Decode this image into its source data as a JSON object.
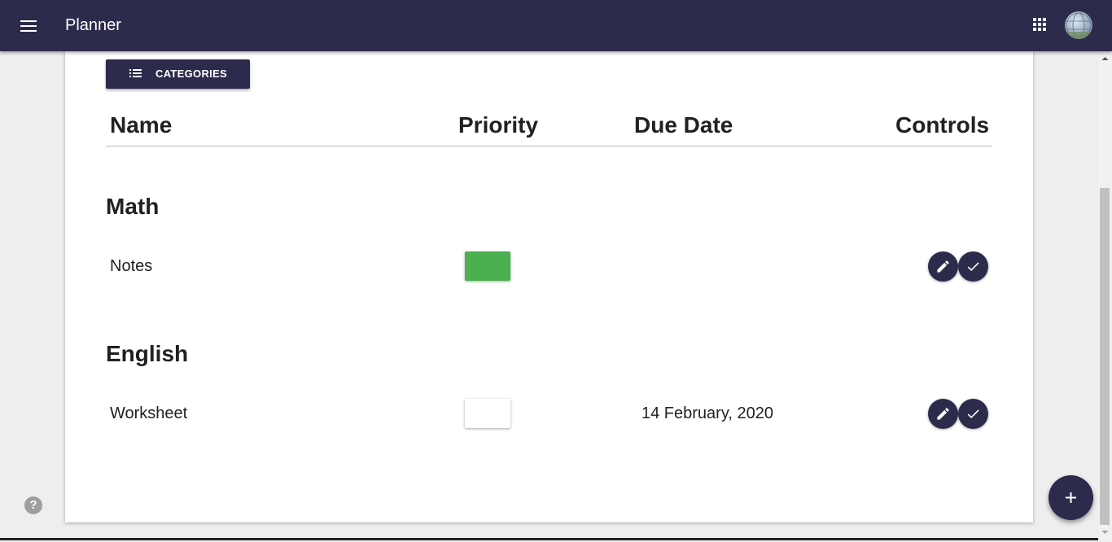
{
  "app": {
    "title": "Planner",
    "menu_icon": "hamburger-menu-icon",
    "apps_icon": "apps-grid-icon",
    "avatar": "user-avatar-globe"
  },
  "toolbar": {
    "categories_label": "CATEGORIES",
    "categories_icon": "list-icon"
  },
  "table": {
    "headers": {
      "name": "Name",
      "priority": "Priority",
      "due_date": "Due Date",
      "controls": "Controls"
    }
  },
  "categories": [
    {
      "title": "Math",
      "tasks": [
        {
          "name": "Notes",
          "priority_color": "#4caf50",
          "due_date": "",
          "controls": [
            "edit-pencil-icon",
            "complete-check-icon"
          ]
        }
      ]
    },
    {
      "title": "English",
      "tasks": [
        {
          "name": "Worksheet",
          "priority_color": "#ffffff",
          "due_date": "14 February, 2020",
          "controls": [
            "edit-pencil-icon",
            "complete-check-icon"
          ]
        }
      ]
    }
  ],
  "help": {
    "symbol": "?"
  },
  "fab": {
    "icon": "plus-icon"
  },
  "colors": {
    "primary": "#2c2b4b",
    "priority_high": "#4caf50",
    "priority_none": "#ffffff",
    "background": "#eeeeee"
  }
}
